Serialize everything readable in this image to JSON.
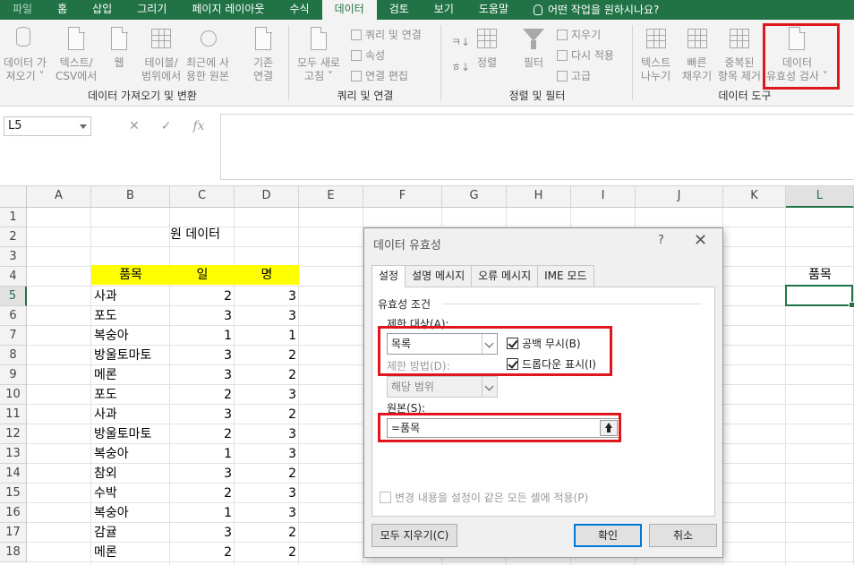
{
  "ribbon_tabs": [
    "파일",
    "홈",
    "삽입",
    "그리기",
    "페이지 레이아웃",
    "수식",
    "데이터",
    "검토",
    "보기",
    "도움말"
  ],
  "active_tab": "데이터",
  "tell_me": "어떤 작업을 원하시나요?",
  "groups": {
    "get_transform": {
      "label": "데이터 가져오기 및 변환",
      "buttons": [
        {
          "line1": "데이터 가",
          "line2": "져오기 ˅"
        },
        {
          "line1": "텍스트/",
          "line2": "CSV에서"
        },
        {
          "line1": "웹",
          "line2": ""
        },
        {
          "line1": "테이블/",
          "line2": "범위에서"
        },
        {
          "line1": "최근에 사",
          "line2": "용한 원본"
        },
        {
          "line1": "기존",
          "line2": "연결"
        }
      ]
    },
    "queries": {
      "label": "쿼리 및 연결",
      "refresh": {
        "line1": "모두 새로",
        "line2": "고침 ˅"
      },
      "items": [
        "쿼리 및 연결",
        "속성",
        "연결 편집"
      ]
    },
    "sort_filter": {
      "label": "정렬 및 필터",
      "sort": "정렬",
      "filter": "필터",
      "items": [
        "지우기",
        "다시 적용",
        "고급"
      ]
    },
    "data_tools": {
      "label": "데이터 도구",
      "buttons": [
        {
          "line1": "텍스트",
          "line2": "나누기"
        },
        {
          "line1": "빠른",
          "line2": "채우기"
        },
        {
          "line1": "중복된",
          "line2": "항목 제거"
        },
        {
          "line1": "데이터",
          "line2": "유효성 검사 ˅"
        }
      ]
    }
  },
  "name_box": "L5",
  "fx_symbols": {
    "cancel": "✕",
    "enter": "✓",
    "fx": "fx"
  },
  "columns": [
    "A",
    "B",
    "C",
    "D",
    "E",
    "F",
    "G",
    "H",
    "I",
    "J",
    "K",
    "L"
  ],
  "rows": [
    "1",
    "2",
    "3",
    "4",
    "5",
    "6",
    "7",
    "8",
    "9",
    "10",
    "11",
    "12",
    "13",
    "14",
    "15",
    "16",
    "17",
    "18"
  ],
  "sheet": {
    "title": "원 데이터",
    "headers": [
      "품목",
      "일",
      "명"
    ],
    "data": [
      [
        "사과",
        "2",
        "3"
      ],
      [
        "포도",
        "3",
        "3"
      ],
      [
        "복숭아",
        "1",
        "1"
      ],
      [
        "방울토마토",
        "3",
        "2"
      ],
      [
        "메론",
        "3",
        "2"
      ],
      [
        "포도",
        "2",
        "3"
      ],
      [
        "사과",
        "3",
        "2"
      ],
      [
        "방울토마토",
        "2",
        "3"
      ],
      [
        "복숭아",
        "1",
        "3"
      ],
      [
        "참외",
        "3",
        "2"
      ],
      [
        "수박",
        "2",
        "3"
      ],
      [
        "복숭아",
        "1",
        "3"
      ],
      [
        "감귤",
        "3",
        "2"
      ],
      [
        "메론",
        "2",
        "2"
      ]
    ],
    "l4": "품목"
  },
  "dialog": {
    "title": "데이터 유효성",
    "help": "?",
    "close": "✕",
    "tabs": [
      "설정",
      "설명 메시지",
      "오류 메시지",
      "IME 모드"
    ],
    "section": "유효성 조건",
    "allow_label": "제한 대상(A):",
    "allow_value": "목록",
    "ignore_blank": "공백 무시(B)",
    "dropdown": "드롭다운 표시(I)",
    "data_label": "제한 방법(D):",
    "data_value": "해당 범위",
    "source_label": "원본(S):",
    "source_value": "=품목",
    "apply_all": "변경 내용을 설정이 같은 모든 셀에 적용(P)",
    "clear_all": "모두 지우기(C)",
    "ok": "확인",
    "cancel": "취소"
  },
  "colors": {
    "excel_green": "#217346",
    "highlight_red": "#e0161e",
    "header_yellow": "#ffff00"
  }
}
